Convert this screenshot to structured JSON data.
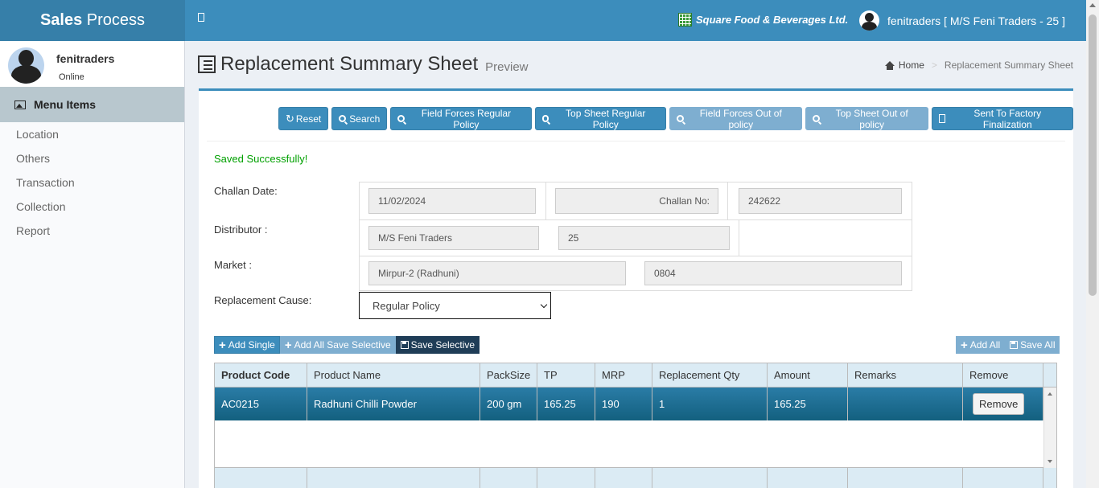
{
  "header": {
    "brand_bold": "Sales",
    "brand_rest": " Process",
    "company": "Square Food & Beverages Ltd.",
    "user_label": "fenitraders [ M/S Feni Traders - 25 ]"
  },
  "sidebar": {
    "username": "fenitraders",
    "status": "Online",
    "menu_header": "Menu Items",
    "items": [
      {
        "label": "Location"
      },
      {
        "label": "Others"
      },
      {
        "label": "Transaction"
      },
      {
        "label": "Collection"
      },
      {
        "label": "Report"
      }
    ]
  },
  "page": {
    "title": "Replacement Summary Sheet",
    "subtitle": "Preview",
    "breadcrumb_home": "Home",
    "breadcrumb_current": "Replacement Summary Sheet"
  },
  "toolbar": {
    "reset": "Reset",
    "search": "Search",
    "ff_regular": "Field Forces Regular Policy",
    "ts_regular": "Top Sheet Regular Policy",
    "ff_out": "Field Forces Out of policy",
    "ts_out": "Top Sheet Out of policy",
    "factory": "Sent To Factory Finalization"
  },
  "form": {
    "saved_msg": "Saved Successfully!",
    "challan_date_label": "Challan Date:",
    "challan_date": "11/02/2024",
    "challan_no_label": "Challan No:",
    "challan_no": "242622",
    "distributor_label": "Distributor :",
    "distributor_name": "M/S Feni Traders",
    "distributor_code": "25",
    "market_label": "Market :",
    "market_name": "Mirpur-2 (Radhuni)",
    "market_code": "0804",
    "cause_label": "Replacement Cause:",
    "cause_value": "Regular Policy"
  },
  "table_actions": {
    "add_single": "Add Single",
    "add_all_save_selective": "Add All Save Selective",
    "save_selective": "Save Selective",
    "add_all": "Add All",
    "save_all": "Save All"
  },
  "table": {
    "headers": [
      "Product Code",
      "Product Name",
      "PackSize",
      "TP",
      "MRP",
      "Replacement Qty",
      "Amount",
      "Remarks",
      "Remove"
    ],
    "rows": [
      {
        "code": "AC0215",
        "name": "Radhuni Chilli Powder",
        "pack": "200 gm",
        "tp": "165.25",
        "mrp": "190",
        "qty": "1",
        "amount": "165.25",
        "remarks": "",
        "remove": "Remove"
      }
    ]
  }
}
